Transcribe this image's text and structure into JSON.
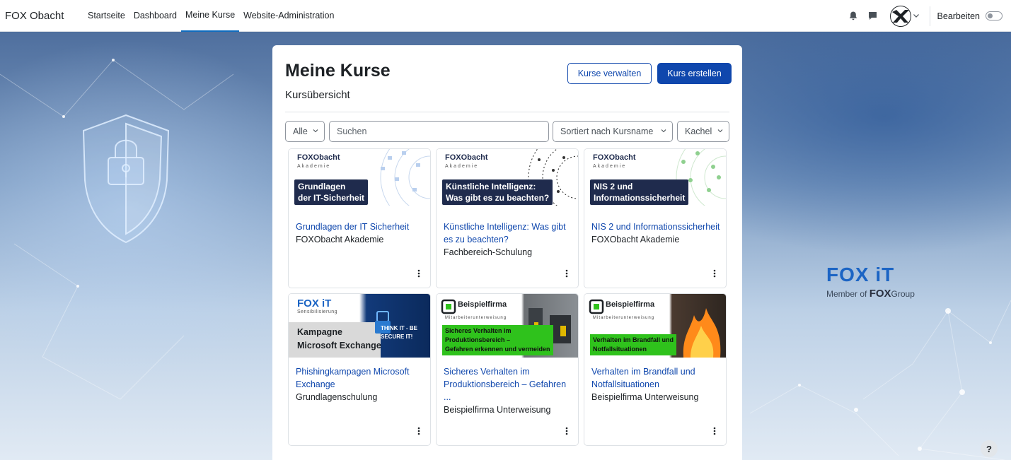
{
  "nav": {
    "brand": "FOX Obacht",
    "links": [
      {
        "label": "Startseite",
        "active": false
      },
      {
        "label": "Dashboard",
        "active": false
      },
      {
        "label": "Meine Kurse",
        "active": true
      },
      {
        "label": "Website-Administration",
        "active": false
      }
    ],
    "edit_label": "Bearbeiten",
    "icons": [
      "bell-icon",
      "chat-icon",
      "avatar",
      "chevron-down-icon"
    ]
  },
  "page": {
    "title": "Meine Kurse",
    "manage_button": "Kurse verwalten",
    "create_button": "Kurs erstellen",
    "section_title": "Kursübersicht"
  },
  "filters": {
    "grouping": "Alle",
    "search_placeholder": "Suchen",
    "sort": "Sortiert nach Kursname",
    "view": "Kachel"
  },
  "courses": [
    {
      "title": "Grundlagen der IT Sicherheit",
      "category": "FOXObacht Akademie",
      "image_logo": "FOXObacht",
      "image_sub": "Akademie",
      "image_line1": "Grundlagen",
      "image_line2": "der IT-Sicherheit"
    },
    {
      "title": "Künstliche Intelligenz: Was gibt es zu beachten?",
      "category": "Fachbereich-Schulung",
      "image_logo": "FOXObacht",
      "image_sub": "Akademie",
      "image_line1": "Künstliche Intelligenz:",
      "image_line2": "Was gibt es zu beachten?"
    },
    {
      "title": "NIS 2 und Informationssicherheit",
      "category": "FOXObacht Akademie",
      "image_logo": "FOXObacht",
      "image_sub": "Akademie",
      "image_line1": "NIS 2 und",
      "image_line2": "Informationssicherheit"
    },
    {
      "title": "Phishingkampagen Microsoft Exchange",
      "category": "Grundlagenschulung",
      "image_logo": "FOX iT",
      "image_sub": "Sensibilisierung",
      "image_line1": "Kampagne",
      "image_line2": "Microsoft Exchange",
      "image_extra": "THINK IT - BE SECURE IT!"
    },
    {
      "title": "Sicheres Verhalten im Produktionsbereich – Gefahren ...",
      "category": "Beispielfirma Unterweisung",
      "image_logo": "Beispielfirma",
      "image_sub": "Mitarbeiterunterweisung",
      "image_line1": "Sicheres Verhalten im",
      "image_line2": "Produktionsbereich –",
      "image_line3": "Gefahren erkennen und vermeiden"
    },
    {
      "title": "Verhalten im Brandfall und Notfallsituationen",
      "category": "Beispielfirma Unterweisung",
      "image_logo": "Beispielfirma",
      "image_sub": "Mitarbeiterunterweisung",
      "image_line1": "Verhalten im Brandfall und",
      "image_line2": "Notfallsituationen"
    }
  ],
  "background": {
    "logo_text": "FOX iT",
    "member_text": "Member of",
    "group_logo": "FOX",
    "group_text": "Group"
  },
  "help_label": "?",
  "colors": {
    "primary": "#0f47ad",
    "link": "#0f47ad",
    "nav_active": "#0f6cbf",
    "label_dark": "#1f2b4d",
    "label_green": "#2fc21c"
  }
}
